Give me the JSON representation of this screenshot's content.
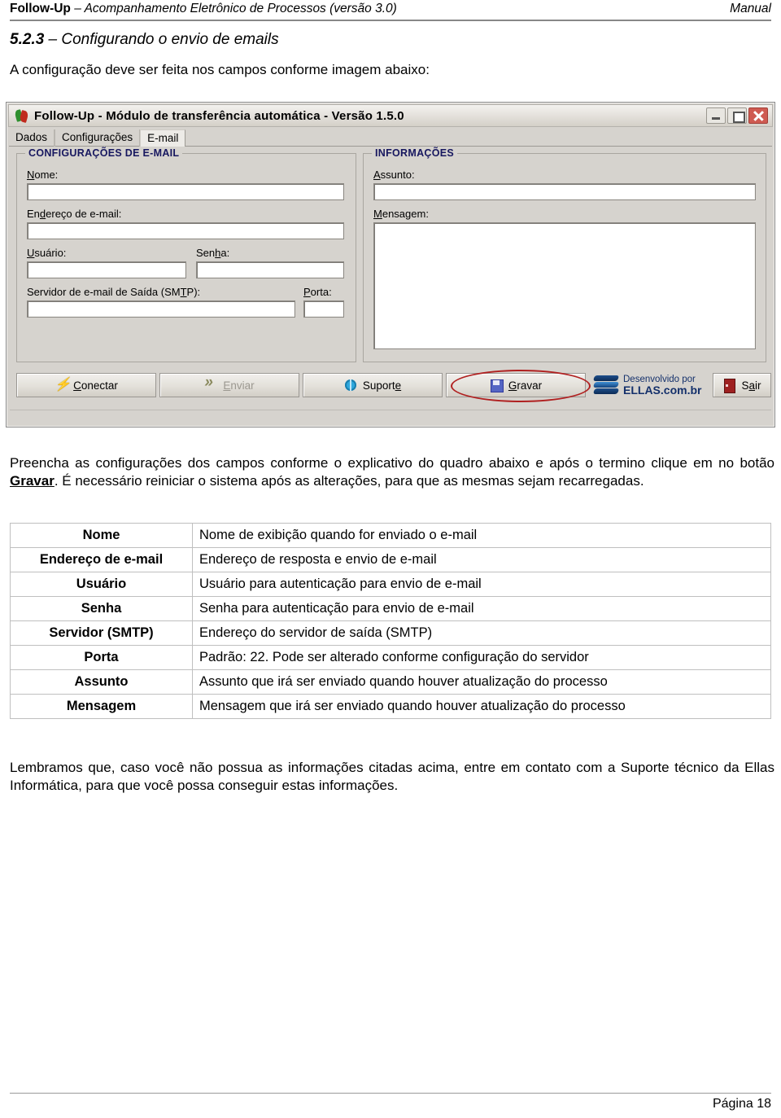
{
  "doc_header": {
    "brand": "Follow-Up",
    "subtitle": " – Acompanhamento Eletrônico de Processos (versão 3.0)",
    "right": "Manual"
  },
  "section": {
    "number": "5.2.3",
    "title": " – Configurando o envio de emails",
    "intro": "A configuração deve ser feita nos campos conforme imagem abaixo:"
  },
  "app": {
    "title": "Follow-Up - Módulo de transferência automática - Versão 1.5.0",
    "icon_name": "followup-app-icon",
    "window_buttons": {
      "minimize": "minimize-icon",
      "maximize": "maximize-icon",
      "close": "close-icon"
    },
    "tabs": [
      {
        "label": "Dados",
        "active": false
      },
      {
        "label": "Configurações",
        "active": false
      },
      {
        "label": "E-mail",
        "active": true
      }
    ],
    "left_group": {
      "legend": "CONFIGURAÇÕES DE E-MAIL",
      "fields": {
        "nome": {
          "label_pre": "",
          "label_accel": "N",
          "label_post": "ome:"
        },
        "endereco": {
          "label_pre": "En",
          "label_accel": "d",
          "label_post": "ereço de e-mail:"
        },
        "usuario": {
          "label_pre": "",
          "label_accel": "U",
          "label_post": "suário:"
        },
        "senha": {
          "label_pre": "Sen",
          "label_accel": "h",
          "label_post": "a:"
        },
        "servidor": {
          "label_pre": "Servidor de e-mail de Saída (SM",
          "label_accel": "T",
          "label_post": "P):"
        },
        "porta": {
          "label_pre": "",
          "label_accel": "P",
          "label_post": "orta:"
        }
      },
      "values": {
        "nome": "",
        "endereco": "",
        "usuario": "",
        "senha": "",
        "servidor": "",
        "porta": ""
      }
    },
    "right_group": {
      "legend": "INFORMAÇÕES",
      "fields": {
        "assunto": {
          "label_pre": "",
          "label_accel": "A",
          "label_post": "ssunto:"
        },
        "mensagem": {
          "label_pre": "",
          "label_accel": "M",
          "label_post": "ensagem:"
        }
      },
      "values": {
        "assunto": "",
        "mensagem": ""
      }
    },
    "buttons": [
      {
        "key": "conectar",
        "pre": "",
        "accel": "C",
        "post": "onectar",
        "icon": "lightning-icon",
        "disabled": false
      },
      {
        "key": "enviar",
        "pre": "",
        "accel": "E",
        "post": "nviar",
        "icon": "double-chevron-icon",
        "disabled": true
      },
      {
        "key": "suporte",
        "pre": "Suport",
        "accel": "e",
        "post": "",
        "icon": "globe-icon",
        "disabled": false
      },
      {
        "key": "gravar",
        "pre": "",
        "accel": "G",
        "post": "ravar",
        "icon": "floppy-save-icon",
        "disabled": false
      },
      {
        "key": "sair",
        "pre": "S",
        "accel": "a",
        "post": "ir",
        "icon": "exit-door-icon",
        "disabled": false
      }
    ],
    "vendor": {
      "line1": "Desenvolvido por",
      "line2": "ELLAS.com.br",
      "logo_name": "ellas-logo-icon"
    },
    "annotation": {
      "name": "red-ellipse-highlight",
      "target": "gravar",
      "color": "#b02020"
    }
  },
  "paragraph_main": {
    "part1": "Preencha as configurações dos campos conforme o explicativo do quadro abaixo e após o termino clique em no botão ",
    "bold": "Gravar",
    "part2": ". É necessário reiniciar o sistema após as alterações, para que as mesmas sejam recarregadas."
  },
  "field_table": {
    "rows": [
      {
        "field": "Nome",
        "description": "Nome de exibição quando for enviado o e-mail"
      },
      {
        "field": "Endereço de e-mail",
        "description": "Endereço de resposta e envio de e-mail"
      },
      {
        "field": "Usuário",
        "description": "Usuário para autenticação para envio de e-mail"
      },
      {
        "field": "Senha",
        "description": "Senha para autenticação para envio de e-mail"
      },
      {
        "field": "Servidor (SMTP)",
        "description": "Endereço do servidor de saída (SMTP)"
      },
      {
        "field": "Porta",
        "description": "Padrão: 22. Pode ser alterado conforme configuração do servidor"
      },
      {
        "field": "Assunto",
        "description": "Assunto que irá ser enviado quando houver atualização do processo"
      },
      {
        "field": "Mensagem",
        "description": "Mensagem que irá ser enviado quando houver atualização do processo"
      }
    ]
  },
  "paragraph_footer": "Lembramos que, caso você não possua as informações citadas acima, entre em contato com a Suporte técnico da Ellas Informática, para que você possa conseguir estas informações.",
  "page_footer": {
    "page_label": "Página 18"
  },
  "colors": {
    "group_legend": "#17175f",
    "vendor_text": "#14306b",
    "annotation": "#b02020",
    "window_chrome": "#d6d3ce"
  }
}
